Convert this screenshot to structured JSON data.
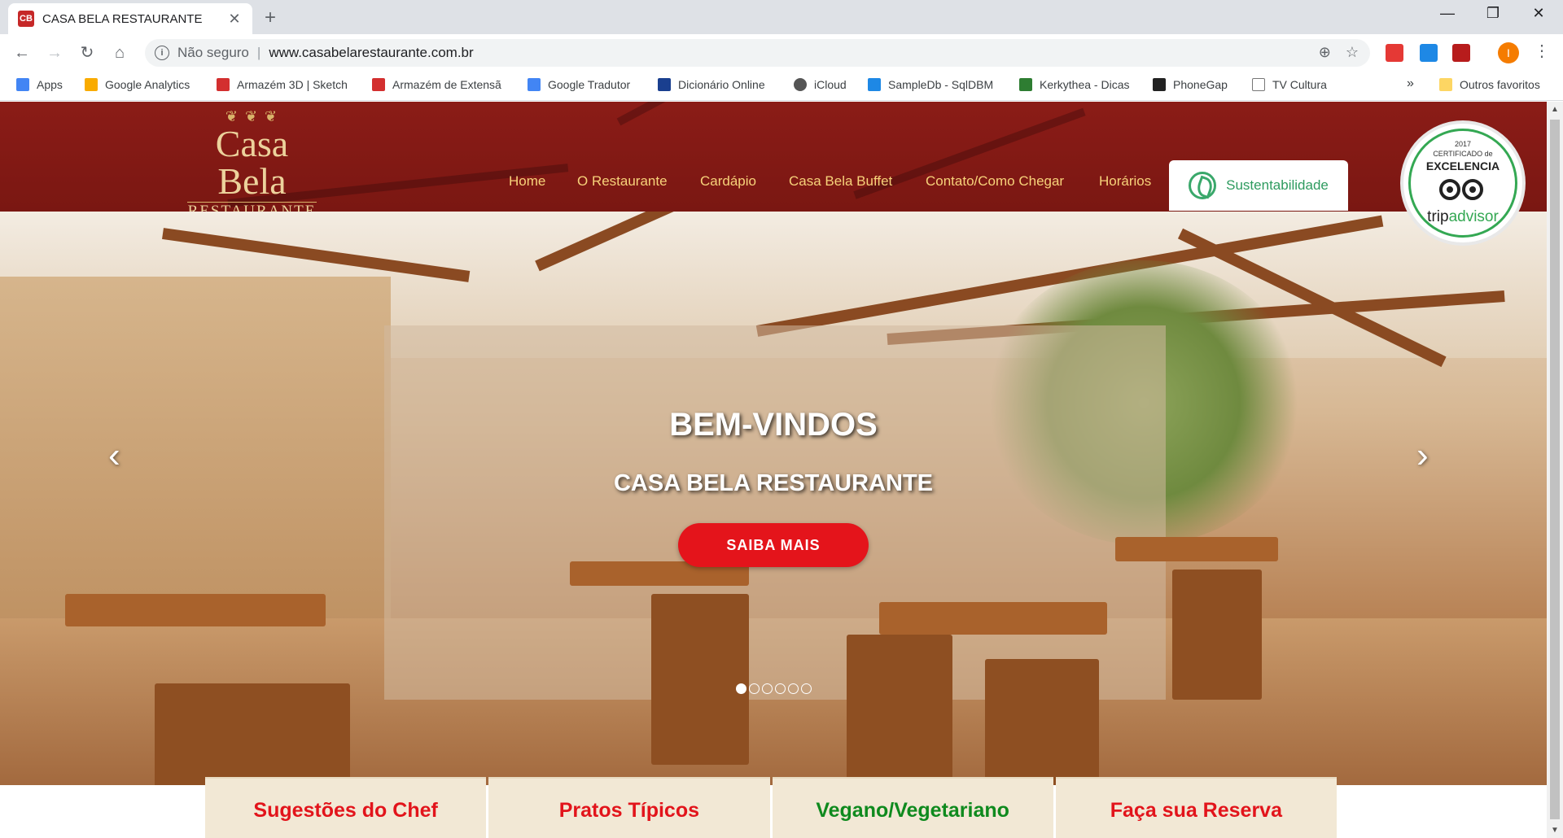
{
  "browser": {
    "tab_title": "CASA BELA RESTAURANTE",
    "tab_favicon": "CB",
    "new_tab": "+",
    "address": {
      "security": "Não seguro",
      "separator": "|",
      "url": "www.casabelarestaurante.com.br"
    },
    "profile_initial": "I",
    "bookmarks": [
      {
        "label": "Apps",
        "icon": "apps-grid-icon",
        "color": "#4285f4"
      },
      {
        "label": "Google Analytics",
        "icon": "analytics-icon",
        "color": "#f9ab00"
      },
      {
        "label": "Armazém 3D | Sketch",
        "icon": "sketchup-icon",
        "color": "#d32f2f"
      },
      {
        "label": "Armazém de Extensã",
        "icon": "sketchup-icon",
        "color": "#d32f2f"
      },
      {
        "label": "Google Tradutor",
        "icon": "translate-icon",
        "color": "#4285f4"
      },
      {
        "label": "Dicionário Online",
        "icon": "dictionary-icon",
        "color": "#1a3f8f"
      },
      {
        "label": "iCloud",
        "icon": "apple-icon",
        "color": "#555555"
      },
      {
        "label": "SampleDb - SqlDBM",
        "icon": "database-icon",
        "color": "#1e88e5"
      },
      {
        "label": "Kerkythea - Dicas",
        "icon": "kerkythea-icon",
        "color": "#2e7d32"
      },
      {
        "label": "PhoneGap",
        "icon": "phonegap-icon",
        "color": "#222222"
      },
      {
        "label": "TV Cultura",
        "icon": "page-icon",
        "color": "#777777"
      }
    ],
    "bookmarks_overflow": "»",
    "other_bookmarks": "Outros favoritos"
  },
  "site": {
    "logo": {
      "main": "Casa Bela",
      "sub": "RESTAURANTE"
    },
    "nav": [
      "Home",
      "O Restaurante",
      "Cardápio",
      "Casa Bela Buffet",
      "Contato/Como Chegar",
      "Horários"
    ],
    "sustainability": "Sustentabilidade",
    "badge": {
      "year": "2017",
      "certificate": "CERTIFICADO de",
      "excellence": "EXCELENCIA",
      "brand_prefix": "trip",
      "brand_suffix": "advisor"
    },
    "hero": {
      "title": "BEM-VINDOS",
      "subtitle": "CASA BELA RESTAURANTE",
      "cta": "SAIBA MAIS",
      "slide_count": 6,
      "active_slide": 1
    },
    "categories": [
      {
        "label": "Sugestões do Chef",
        "color": "#e2141b"
      },
      {
        "label": "Pratos Típicos",
        "color": "#e2141b"
      },
      {
        "label": "Vegano/Vegetariano",
        "color": "#0f8a1e"
      },
      {
        "label": "Faça sua Reserva",
        "color": "#e2141b"
      }
    ]
  }
}
